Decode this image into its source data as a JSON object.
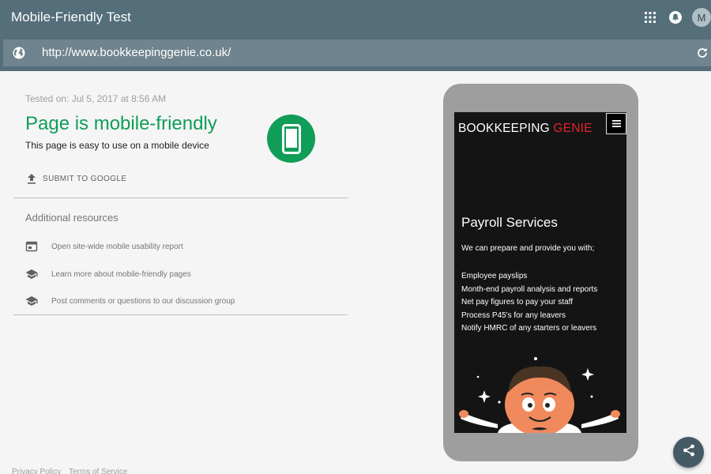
{
  "header": {
    "title": "Mobile-Friendly Test",
    "avatar_initial": "M",
    "icons": [
      "apps-grid-icon",
      "notifications-icon"
    ]
  },
  "url_bar": {
    "url": "http://www.bookkeepinggenie.co.uk/",
    "left_icon": "globe-icon",
    "right_icon": "reload-icon"
  },
  "result": {
    "tested_on": "Tested on: Jul 5, 2017 at 8:56 AM",
    "title": "Page is mobile-friendly",
    "description": "This page is easy to use on a mobile device",
    "icon": "phone-icon",
    "accent_color": "#0f9d58"
  },
  "actions": {
    "submit_label": "SUBMIT TO GOOGLE"
  },
  "resources": {
    "heading": "Additional resources",
    "items": [
      {
        "label": "Open site-wide mobile usability report",
        "icon": "web-icon"
      },
      {
        "label": "Learn more about mobile-friendly pages",
        "icon": "school-icon"
      },
      {
        "label": "Post comments or questions to our discussion group",
        "icon": "school-icon"
      }
    ]
  },
  "preview": {
    "logo_main": "BOOKKEEPING ",
    "logo_accent": "GENIE",
    "logo_accent_color": "#e3242b",
    "heading": "Payroll Services",
    "intro": "We can prepare and provide you with;",
    "list": [
      "Employee payslips",
      "Month-end payroll analysis and reports",
      "Net pay figures to pay your staff",
      "Process P45's for any leavers",
      "Notify HMRC of any starters or leavers"
    ]
  },
  "footer": {
    "privacy": "Privacy Policy",
    "terms": "Terms of Service"
  }
}
